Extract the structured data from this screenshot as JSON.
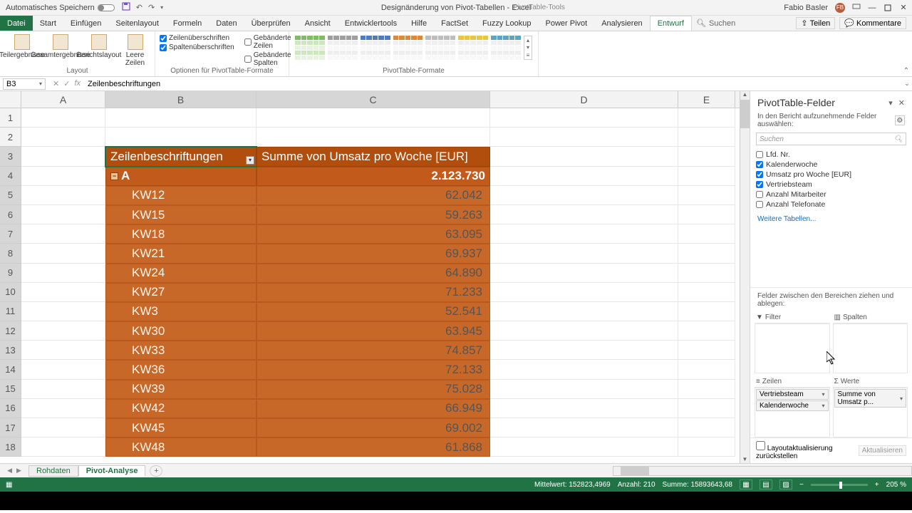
{
  "titlebar": {
    "autosave": "Automatisches Speichern",
    "doc_title": "Designänderung von Pivot-Tabellen - Excel",
    "tool_context": "PivotTable-Tools",
    "user": "Fabio Basler",
    "avatar_initials": "FB"
  },
  "tabs": {
    "file": "Datei",
    "items": [
      "Start",
      "Einfügen",
      "Seitenlayout",
      "Formeln",
      "Daten",
      "Überprüfen",
      "Ansicht",
      "Entwicklertools",
      "Hilfe",
      "FactSet",
      "Fuzzy Lookup",
      "Power Pivot",
      "Analysieren",
      "Entwurf"
    ],
    "active": "Entwurf",
    "search": "Suchen",
    "share": "Teilen",
    "comments": "Kommentare"
  },
  "ribbon": {
    "g1": {
      "b1": "Teilergebnisse",
      "b2": "Gesamtergebnisse",
      "label": "Layout"
    },
    "g2": {
      "b1": "Berichtslayout",
      "b2": "Leere Zeilen"
    },
    "g3": {
      "c1": "Zeilenüberschriften",
      "c2": "Spaltenüberschriften",
      "c3": "Gebänderte Zeilen",
      "c4": "Gebänderte Spalten",
      "label": "Optionen für PivotTable-Formate"
    },
    "g4": {
      "label": "PivotTable-Formate"
    }
  },
  "formula": {
    "namebox": "B3",
    "value": "Zeilenbeschriftungen"
  },
  "columns": [
    "A",
    "B",
    "C",
    "D",
    "E"
  ],
  "pivottable": {
    "hdr_b": "Zeilenbeschriftungen",
    "hdr_c": "Summe von Umsatz pro Woche [EUR]",
    "group": "A",
    "group_total": "2.123.730",
    "rows": [
      {
        "k": "KW12",
        "v": "62.042"
      },
      {
        "k": "KW15",
        "v": "59.263"
      },
      {
        "k": "KW18",
        "v": "63.095"
      },
      {
        "k": "KW21",
        "v": "69.937"
      },
      {
        "k": "KW24",
        "v": "64.890"
      },
      {
        "k": "KW27",
        "v": "71.233"
      },
      {
        "k": "KW3",
        "v": "52.541"
      },
      {
        "k": "KW30",
        "v": "63.945"
      },
      {
        "k": "KW33",
        "v": "74.857"
      },
      {
        "k": "KW36",
        "v": "72.133"
      },
      {
        "k": "KW39",
        "v": "75.028"
      },
      {
        "k": "KW42",
        "v": "66.949"
      },
      {
        "k": "KW45",
        "v": "69.002"
      },
      {
        "k": "KW48",
        "v": "61.868"
      }
    ]
  },
  "fields": {
    "title": "PivotTable-Felder",
    "sub": "In den Bericht aufzunehmende Felder auswählen:",
    "search_placeholder": "Suchen",
    "list": [
      {
        "n": "Lfd. Nr.",
        "c": false
      },
      {
        "n": "Kalenderwoche",
        "c": true
      },
      {
        "n": "Umsatz pro Woche [EUR]",
        "c": true
      },
      {
        "n": "Vertriebsteam",
        "c": true
      },
      {
        "n": "Anzahl Mitarbeiter",
        "c": false
      },
      {
        "n": "Anzahl Telefonate",
        "c": false
      }
    ],
    "more": "Weitere Tabellen...",
    "drag_hint": "Felder zwischen den Bereichen ziehen und ablegen:",
    "areas": {
      "filter": "Filter",
      "cols": "Spalten",
      "rows": "Zeilen",
      "vals": "Werte",
      "row_items": [
        "Vertriebsteam",
        "Kalenderwoche"
      ],
      "val_items": [
        "Summe von Umsatz p..."
      ]
    },
    "defer": "Layoutaktualisierung zurückstellen",
    "update": "Aktualisieren"
  },
  "sheets": {
    "s1": "Rohdaten",
    "s2": "Pivot-Analyse"
  },
  "status": {
    "avg": "Mittelwert: 152823,4969",
    "count": "Anzahl: 210",
    "sum": "Summe: 15893643,68",
    "zoom": "205 %"
  },
  "style_colors": [
    "#7bbf5e",
    "#9e9e9e",
    "#4a7ec2",
    "#d98a3a",
    "#bdbdbd",
    "#e8c547",
    "#5aa5c4"
  ]
}
